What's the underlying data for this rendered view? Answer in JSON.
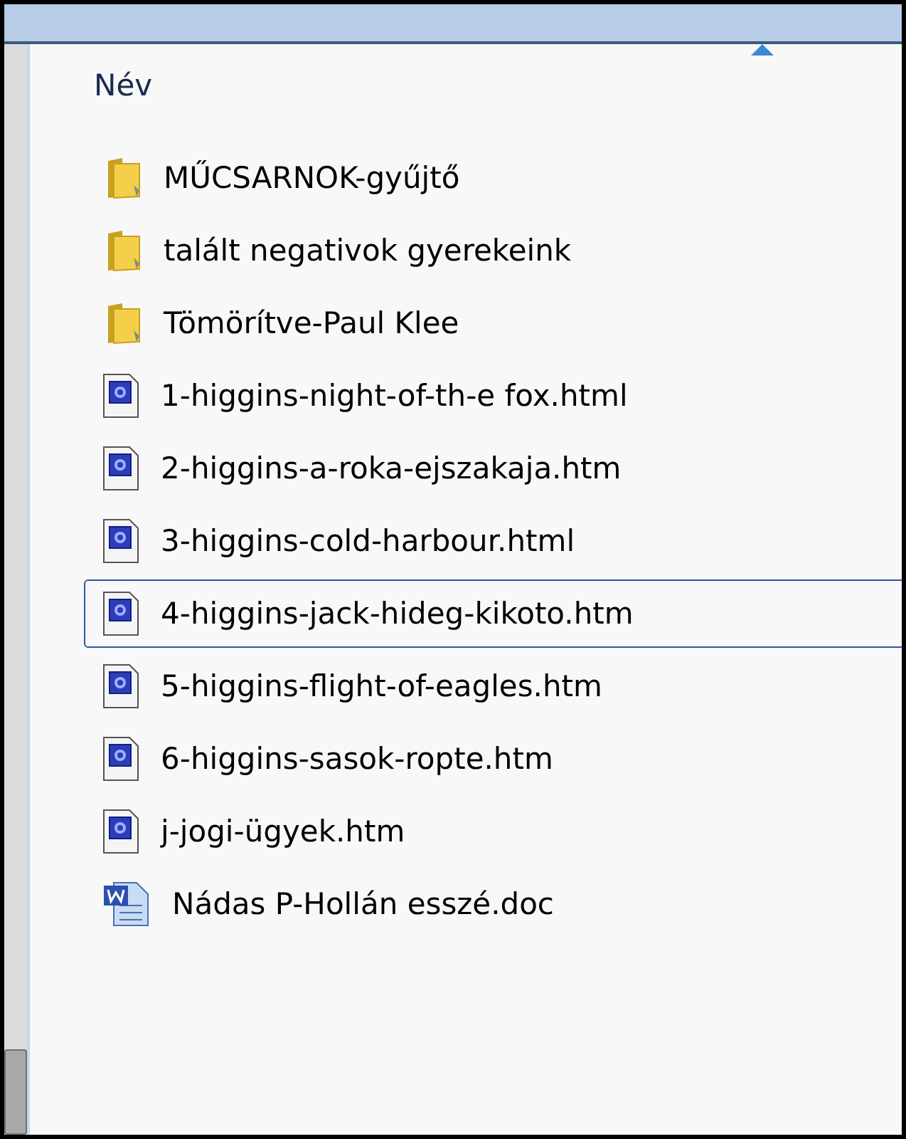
{
  "column_header": {
    "label": "Név"
  },
  "files": [
    {
      "name": "MŰCSARNOK-gyűjtő",
      "kind": "folder",
      "selected": false
    },
    {
      "name": "talált negativok gyerekeink",
      "kind": "folder",
      "selected": false
    },
    {
      "name": "Tömörítve-Paul Klee",
      "kind": "folder",
      "selected": false
    },
    {
      "name": "1-higgins-night-of-th-e fox.html",
      "kind": "html",
      "selected": false
    },
    {
      "name": "2-higgins-a-roka-ejszakaja.htm",
      "kind": "html",
      "selected": false
    },
    {
      "name": "3-higgins-cold-harbour.html",
      "kind": "html",
      "selected": false
    },
    {
      "name": "4-higgins-jack-hideg-kikoto.htm",
      "kind": "html",
      "selected": true
    },
    {
      "name": "5-higgins-flight-of-eagles.htm",
      "kind": "html",
      "selected": false
    },
    {
      "name": "6-higgins-sasok-ropte.htm",
      "kind": "html",
      "selected": false
    },
    {
      "name": "j-jogi-ügyek.htm",
      "kind": "html",
      "selected": false
    },
    {
      "name": "Nádas P-Hollán esszé.doc",
      "kind": "doc",
      "selected": false
    }
  ]
}
